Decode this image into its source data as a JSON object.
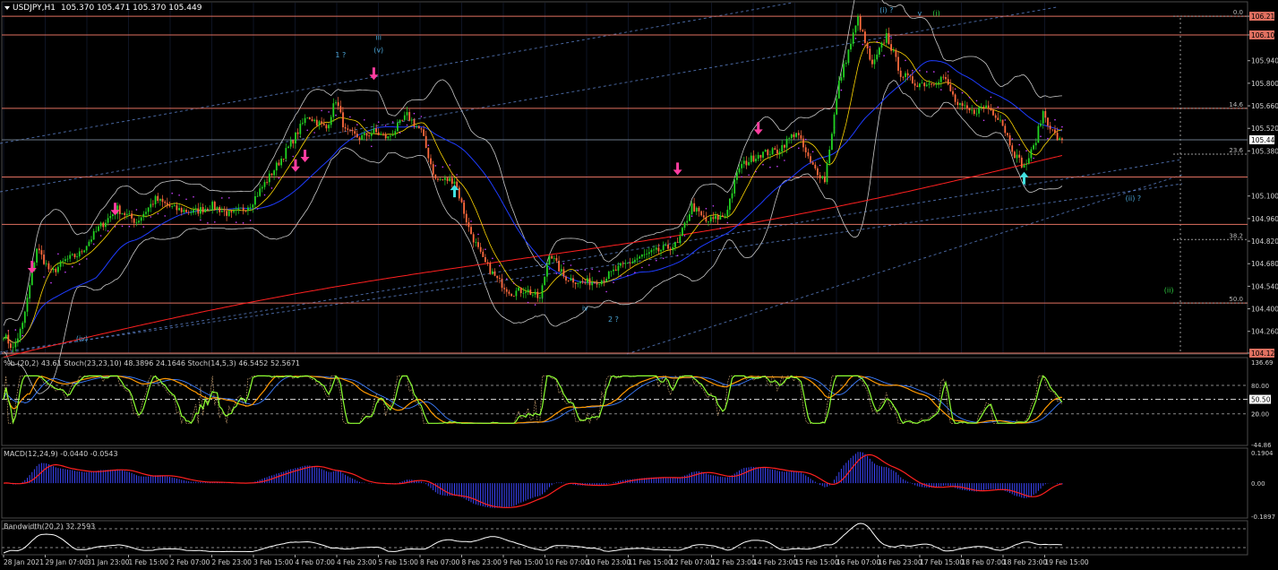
{
  "header": {
    "symbol": "USDJPY,H1",
    "ohlc": "105.370 105.471 105.370 105.449"
  },
  "colors": {
    "background": "#000000",
    "grid": "#1f2a44",
    "bull": "#22d322",
    "bear": "#ff6a3d",
    "hline": "#e07060",
    "channel": "#5a7fc6",
    "ma_fast": "#ffd700",
    "ma_mid": "#1e3cff",
    "ma_slow": "#ff2020",
    "bands": "#c8c8c8",
    "sar": "#c840ff",
    "stoch_main": "#8cff32",
    "stoch_sig": "#ff9900",
    "macd_hist": "#3c46ff",
    "macd_signal": "#ff2020",
    "bandwidth": "#ffffff",
    "pink_arrow": "#ff3ca0",
    "cyan_arrow": "#40e0e0",
    "wave_label": "#4aa3d4",
    "price_tag_bg": "#e07060",
    "current_tag_bg": "#ffffff"
  },
  "chart_data": {
    "type": "candlestick",
    "price_axis": {
      "ylim": [
        104.125,
        106.3
      ],
      "ticks": [
        "106.216",
        "106.100",
        "105.940",
        "105.800",
        "105.660",
        "105.520",
        "105.380",
        "105.100",
        "104.960",
        "104.820",
        "104.680",
        "104.540",
        "104.400",
        "104.260",
        "104.125"
      ],
      "tick_values": [
        106.216,
        106.1,
        105.94,
        105.8,
        105.66,
        105.52,
        105.38,
        105.1,
        104.96,
        104.82,
        104.68,
        104.54,
        104.4,
        104.26,
        104.125
      ]
    },
    "current_price": {
      "label": "105.449",
      "value": 105.449
    },
    "horizontal_levels": [
      {
        "value": 106.216,
        "label": "106.216"
      },
      {
        "value": 106.1,
        "label": "106.100"
      },
      {
        "value": 105.644,
        "label": "105.644"
      },
      {
        "value": 105.218,
        "label": "105.218"
      },
      {
        "value": 104.924,
        "label": "104.924"
      },
      {
        "value": 104.436,
        "label": "104.436"
      },
      {
        "value": 104.125,
        "label": "104.125"
      }
    ],
    "fib_labels": [
      {
        "value": 106.216,
        "label": "0.0"
      },
      {
        "value": 105.644,
        "label": "14.6"
      },
      {
        "value": 105.36,
        "label": "23.6"
      },
      {
        "value": 104.83,
        "label": "38.2"
      },
      {
        "value": 104.436,
        "label": "50.0"
      }
    ],
    "x_ticks": [
      "28 Jan 2021",
      "29 Jan 07:00",
      "31 Jan 23:00",
      "1 Feb 15:00",
      "2 Feb 07:00",
      "2 Feb 23:00",
      "3 Feb 15:00",
      "4 Feb 07:00",
      "4 Feb 23:00",
      "5 Feb 15:00",
      "8 Feb 07:00",
      "8 Feb 23:00",
      "9 Feb 15:00",
      "10 Feb 07:00",
      "10 Feb 23:00",
      "11 Feb 15:00",
      "12 Feb 07:00",
      "12 Feb 23:00",
      "14 Feb 23:00",
      "15 Feb 15:00",
      "16 Feb 07:00",
      "16 Feb 23:00",
      "17 Feb 15:00",
      "18 Feb 07:00",
      "18 Feb 23:00",
      "19 Feb 15:00"
    ],
    "price_path": [
      [
        0,
        104.24
      ],
      [
        4,
        104.15
      ],
      [
        8,
        104.3
      ],
      [
        14,
        104.78
      ],
      [
        20,
        104.62
      ],
      [
        26,
        104.7
      ],
      [
        32,
        104.74
      ],
      [
        40,
        104.9
      ],
      [
        48,
        105.02
      ],
      [
        56,
        104.94
      ],
      [
        64,
        105.08
      ],
      [
        72,
        105.02
      ],
      [
        80,
        105.0
      ],
      [
        88,
        105.04
      ],
      [
        96,
        104.98
      ],
      [
        104,
        105.05
      ],
      [
        112,
        105.22
      ],
      [
        120,
        105.4
      ],
      [
        128,
        105.6
      ],
      [
        136,
        105.52
      ],
      [
        140,
        105.7
      ],
      [
        144,
        105.5
      ],
      [
        150,
        105.46
      ],
      [
        156,
        105.5
      ],
      [
        162,
        105.46
      ],
      [
        170,
        105.6
      ],
      [
        176,
        105.5
      ],
      [
        182,
        105.2
      ],
      [
        190,
        105.2
      ],
      [
        196,
        104.9
      ],
      [
        202,
        104.7
      ],
      [
        208,
        104.58
      ],
      [
        214,
        104.5
      ],
      [
        220,
        104.52
      ],
      [
        226,
        104.46
      ],
      [
        230,
        104.75
      ],
      [
        236,
        104.6
      ],
      [
        244,
        104.56
      ],
      [
        252,
        104.58
      ],
      [
        260,
        104.66
      ],
      [
        268,
        104.72
      ],
      [
        276,
        104.76
      ],
      [
        284,
        104.8
      ],
      [
        290,
        105.04
      ],
      [
        296,
        104.94
      ],
      [
        304,
        104.98
      ],
      [
        310,
        105.28
      ],
      [
        318,
        105.36
      ],
      [
        326,
        105.38
      ],
      [
        334,
        105.5
      ],
      [
        340,
        105.3
      ],
      [
        346,
        105.2
      ],
      [
        352,
        105.8
      ],
      [
        360,
        106.2
      ],
      [
        366,
        105.9
      ],
      [
        372,
        106.1
      ],
      [
        378,
        105.86
      ],
      [
        384,
        105.8
      ],
      [
        390,
        105.8
      ],
      [
        396,
        105.84
      ],
      [
        402,
        105.66
      ],
      [
        408,
        105.62
      ],
      [
        414,
        105.66
      ],
      [
        420,
        105.58
      ],
      [
        426,
        105.36
      ],
      [
        430,
        105.28
      ],
      [
        434,
        105.4
      ],
      [
        438,
        105.62
      ],
      [
        442,
        105.5
      ],
      [
        446,
        105.42
      ]
    ],
    "bar_count": 447,
    "pink_down_arrows": [
      [
        12,
        104.62
      ],
      [
        47,
        104.98
      ],
      [
        123,
        105.25
      ],
      [
        127,
        105.31
      ],
      [
        156,
        105.82
      ],
      [
        284,
        105.23
      ],
      [
        318,
        105.48
      ]
    ],
    "cyan_up_arrows": [
      [
        190,
        105.17
      ],
      [
        430,
        105.25
      ]
    ],
    "wave_labels": [
      {
        "text": "iii",
        "bar": 158,
        "value": 106.07,
        "color": "#4aa3d4"
      },
      {
        "text": "(v)",
        "bar": 158,
        "value": 105.99,
        "color": "#4aa3d4"
      },
      {
        "text": "1 ?",
        "bar": 142,
        "value": 105.96,
        "color": "#4aa3d4"
      },
      {
        "text": "(iv)",
        "bar": 33,
        "value": 104.2,
        "color": "#4aa3d4"
      },
      {
        "text": "iv",
        "bar": 245,
        "value": 104.39,
        "color": "#4aa3d4"
      },
      {
        "text": "2 ?",
        "bar": 257,
        "value": 104.32,
        "color": "#4aa3d4"
      },
      {
        "text": "(i) ?",
        "bar": 372,
        "value": 106.24,
        "color": "#4aa3d4"
      },
      {
        "text": "v",
        "bar": 386,
        "value": 106.22,
        "color": "#4aa3d4"
      },
      {
        "text": "(i)",
        "bar": 393,
        "value": 106.22,
        "color": "#2ecc40"
      },
      {
        "text": "(ii) ?",
        "bar": 476,
        "value": 105.07,
        "color": "#4aa3d4"
      },
      {
        "text": "(ii)",
        "bar": 491,
        "value": 104.5,
        "color": "#2ecc40"
      }
    ],
    "stoch_panel": {
      "label": "%b (20,2) 43.61  Stoch(23,23,10) 48.3896 24.1646  Stoch(14,5,3) 46.5452 52.5671",
      "ylim": [
        -44.86,
        136.69
      ],
      "ticks": [
        "136.69",
        "80.00",
        "50.50",
        "20.00",
        "20",
        "-44.86"
      ],
      "tick_values": [
        136.69,
        80,
        50.5,
        20,
        20,
        -44.86
      ],
      "levels": [
        80,
        50.5,
        20
      ]
    },
    "macd_panel": {
      "label": "MACD(12,24,9) -0.0440 -0.0543",
      "ylim": [
        -0.1897,
        0.1904
      ],
      "ticks": [
        "0.1904",
        "0.00",
        "-0.1897"
      ],
      "tick_values": [
        0.1904,
        0.0,
        -0.1897
      ]
    },
    "bandwidth_panel": {
      "label": "Bandwidth(20,2) 32.2593"
    }
  }
}
